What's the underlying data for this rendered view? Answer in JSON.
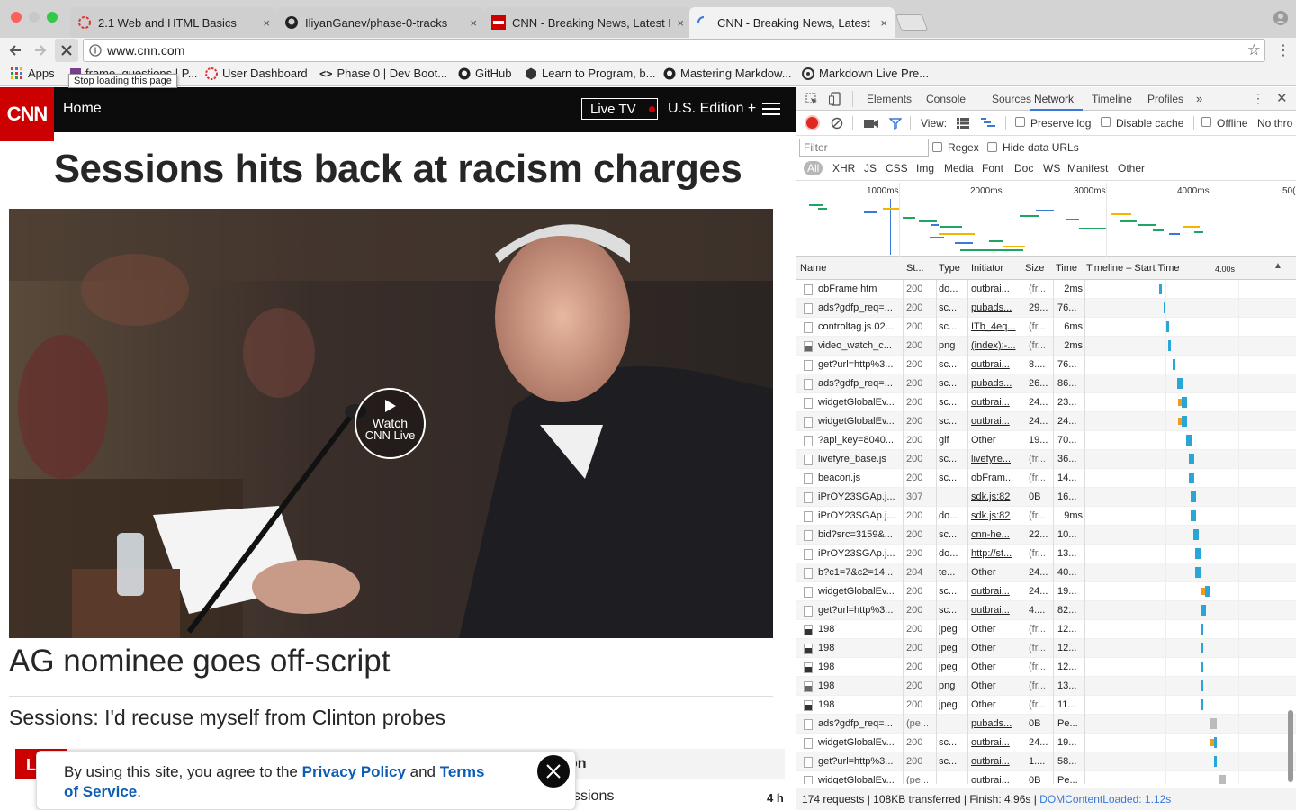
{
  "browser": {
    "tabs": [
      {
        "title": "2.1 Web and HTML Basics",
        "close": "×"
      },
      {
        "title": "IliyanGanev/phase-0-tracks",
        "close": "×"
      },
      {
        "title": "CNN - Breaking News, Latest N",
        "close": "×"
      },
      {
        "title": "CNN - Breaking News, Latest N",
        "close": "×"
      }
    ],
    "url": "www.cnn.com",
    "bookmarks": [
      {
        "label": "Apps"
      },
      {
        "label": "frame_questions | P..."
      },
      {
        "label": "User Dashboard"
      },
      {
        "label": "Phase 0 | Dev Boot..."
      },
      {
        "label": "GitHub"
      },
      {
        "label": "Learn to Program, b..."
      },
      {
        "label": "Mastering Markdow..."
      },
      {
        "label": "Markdown Live Pre..."
      }
    ],
    "tooltip": "Stop loading this page"
  },
  "cnn": {
    "logo": "CNN",
    "nav_home": "Home",
    "live_tv": "Live TV",
    "edition": "U.S. Edition +",
    "headline": "Sessions hits back at racism charges",
    "video_cta_line1": "Watch",
    "video_cta_line2": "CNN Live",
    "sub_headline": "AG nominee goes off-script",
    "secondary_headline": "Sessions: I'd recuse myself from Clinton probes",
    "bottom_partial_left": "L",
    "bottom_partial_right": "on",
    "bottom_partial_text": "ssions",
    "bottom_time": "4 h",
    "privacy": {
      "text_prefix": "By using this site, you agree to the ",
      "privacy_link": "Privacy Policy",
      "and": " and ",
      "terms_link": "Terms of Service",
      "suffix": "."
    }
  },
  "devtools": {
    "panels": [
      "Elements",
      "Console",
      "Sources",
      "Network",
      "Timeline",
      "Profiles"
    ],
    "active_panel": "Network",
    "more": "»",
    "view_label": "View:",
    "preserve_log": "Preserve log",
    "disable_cache": "Disable cache",
    "offline": "Offline",
    "throttle": "No thro",
    "filter_placeholder": "Filter",
    "regex": "Regex",
    "hide_data_urls": "Hide data URLs",
    "types": [
      "All",
      "XHR",
      "JS",
      "CSS",
      "Img",
      "Media",
      "Font",
      "Doc",
      "WS",
      "Manifest",
      "Other"
    ],
    "overview_ticks": [
      "1000ms",
      "2000ms",
      "3000ms",
      "4000ms",
      "50("
    ],
    "columns": [
      "Name",
      "St...",
      "Type",
      "Initiator",
      "Size",
      "Time",
      "Timeline – Start Time"
    ],
    "timeline_tick": "4.00s",
    "rows": [
      {
        "name": "obFrame.htm",
        "status": "200",
        "type": "do...",
        "initiator": "outbrai...",
        "size": "(fr...",
        "time": "2ms",
        "wf": 0.16
      },
      {
        "name": "ads?gdfp_req=...",
        "status": "200",
        "type": "sc...",
        "initiator": "pubads...",
        "size": "29...",
        "time": "76...",
        "wf": 0.17
      },
      {
        "name": "controltag.js.02...",
        "status": "200",
        "type": "sc...",
        "initiator": "ITb_4eq...",
        "size": "(fr...",
        "time": "6ms",
        "wf": 0.175
      },
      {
        "name": "video_watch_c...",
        "status": "200",
        "type": "png",
        "initiator": "(index):-...",
        "size": "(fr...",
        "time": "2ms",
        "wf": 0.18
      },
      {
        "name": "get?url=http%3...",
        "status": "200",
        "type": "sc...",
        "initiator": "outbrai...",
        "size": "8....",
        "time": "76...",
        "wf": 0.19
      },
      {
        "name": "ads?gdfp_req=...",
        "status": "200",
        "type": "sc...",
        "initiator": "pubads...",
        "size": "26...",
        "time": "86...",
        "wf": 0.2
      },
      {
        "name": "widgetGlobalEv...",
        "status": "200",
        "type": "sc...",
        "initiator": "outbrai...",
        "size": "24...",
        "time": "23...",
        "wf": 0.21
      },
      {
        "name": "widgetGlobalEv...",
        "status": "200",
        "type": "sc...",
        "initiator": "outbrai...",
        "size": "24...",
        "time": "24...",
        "wf": 0.21
      },
      {
        "name": "?api_key=8040...",
        "status": "200",
        "type": "gif",
        "initiator": "Other",
        "size": "19...",
        "time": "70...",
        "wf": 0.22
      },
      {
        "name": "livefyre_base.js",
        "status": "200",
        "type": "sc...",
        "initiator": "livefyre...",
        "size": "(fr...",
        "time": "36...",
        "wf": 0.225
      },
      {
        "name": "beacon.js",
        "status": "200",
        "type": "sc...",
        "initiator": "obFram...",
        "size": "(fr...",
        "time": "14...",
        "wf": 0.225
      },
      {
        "name": "iPrOY23SGAp.j...",
        "status": "307",
        "type": "",
        "initiator": "sdk.js:82",
        "size": "0B",
        "time": "16...",
        "wf": 0.23
      },
      {
        "name": "iPrOY23SGAp.j...",
        "status": "200",
        "type": "do...",
        "initiator": "sdk.js:82",
        "size": "(fr...",
        "time": "9ms",
        "wf": 0.23
      },
      {
        "name": "bid?src=3159&...",
        "status": "200",
        "type": "sc...",
        "initiator": "cnn-he...",
        "size": "22...",
        "time": "10...",
        "wf": 0.235
      },
      {
        "name": "iPrOY23SGAp.j...",
        "status": "200",
        "type": "do...",
        "initiator": "http://st...",
        "size": "(fr...",
        "time": "13...",
        "wf": 0.24
      },
      {
        "name": "b?c1=7&c2=14...",
        "status": "204",
        "type": "te...",
        "initiator": "Other",
        "size": "24...",
        "time": "40...",
        "wf": 0.24
      },
      {
        "name": "widgetGlobalEv...",
        "status": "200",
        "type": "sc...",
        "initiator": "outbrai...",
        "size": "24...",
        "time": "19...",
        "wf": 0.26
      },
      {
        "name": "get?url=http%3...",
        "status": "200",
        "type": "sc...",
        "initiator": "outbrai...",
        "size": "4....",
        "time": "82...",
        "wf": 0.25
      },
      {
        "name": "198",
        "status": "200",
        "type": "jpeg",
        "initiator": "Other",
        "size": "(fr...",
        "time": "12...",
        "wf": 0.25
      },
      {
        "name": "198",
        "status": "200",
        "type": "jpeg",
        "initiator": "Other",
        "size": "(fr...",
        "time": "12...",
        "wf": 0.25
      },
      {
        "name": "198",
        "status": "200",
        "type": "jpeg",
        "initiator": "Other",
        "size": "(fr...",
        "time": "12...",
        "wf": 0.25
      },
      {
        "name": "198",
        "status": "200",
        "type": "png",
        "initiator": "Other",
        "size": "(fr...",
        "time": "13...",
        "wf": 0.25
      },
      {
        "name": "198",
        "status": "200",
        "type": "jpeg",
        "initiator": "Other",
        "size": "(fr...",
        "time": "11...",
        "wf": 0.25
      },
      {
        "name": "ads?gdfp_req=...",
        "status": "(pe...",
        "type": "",
        "initiator": "pubads...",
        "size": "0B",
        "time": "Pe...",
        "wf": 0.27
      },
      {
        "name": "widgetGlobalEv...",
        "status": "200",
        "type": "sc...",
        "initiator": "outbrai...",
        "size": "24...",
        "time": "19...",
        "wf": 0.28
      },
      {
        "name": "get?url=http%3...",
        "status": "200",
        "type": "sc...",
        "initiator": "outbrai...",
        "size": "1....",
        "time": "58...",
        "wf": 0.28
      },
      {
        "name": "widgetGlobalEv...",
        "status": "(pe...",
        "type": "",
        "initiator": "outbrai...",
        "size": "0B",
        "time": "Pe...",
        "wf": 0.29
      }
    ],
    "summary_prefix": "174 requests | 108KB transferred | Finish: 4.96s | ",
    "summary_dom": "DOMContentLoaded: 1.12s"
  },
  "colors": {
    "cnn_red": "#cc0000",
    "link_blue": "#0c5cb5",
    "devtools_active": "#3879d9"
  }
}
